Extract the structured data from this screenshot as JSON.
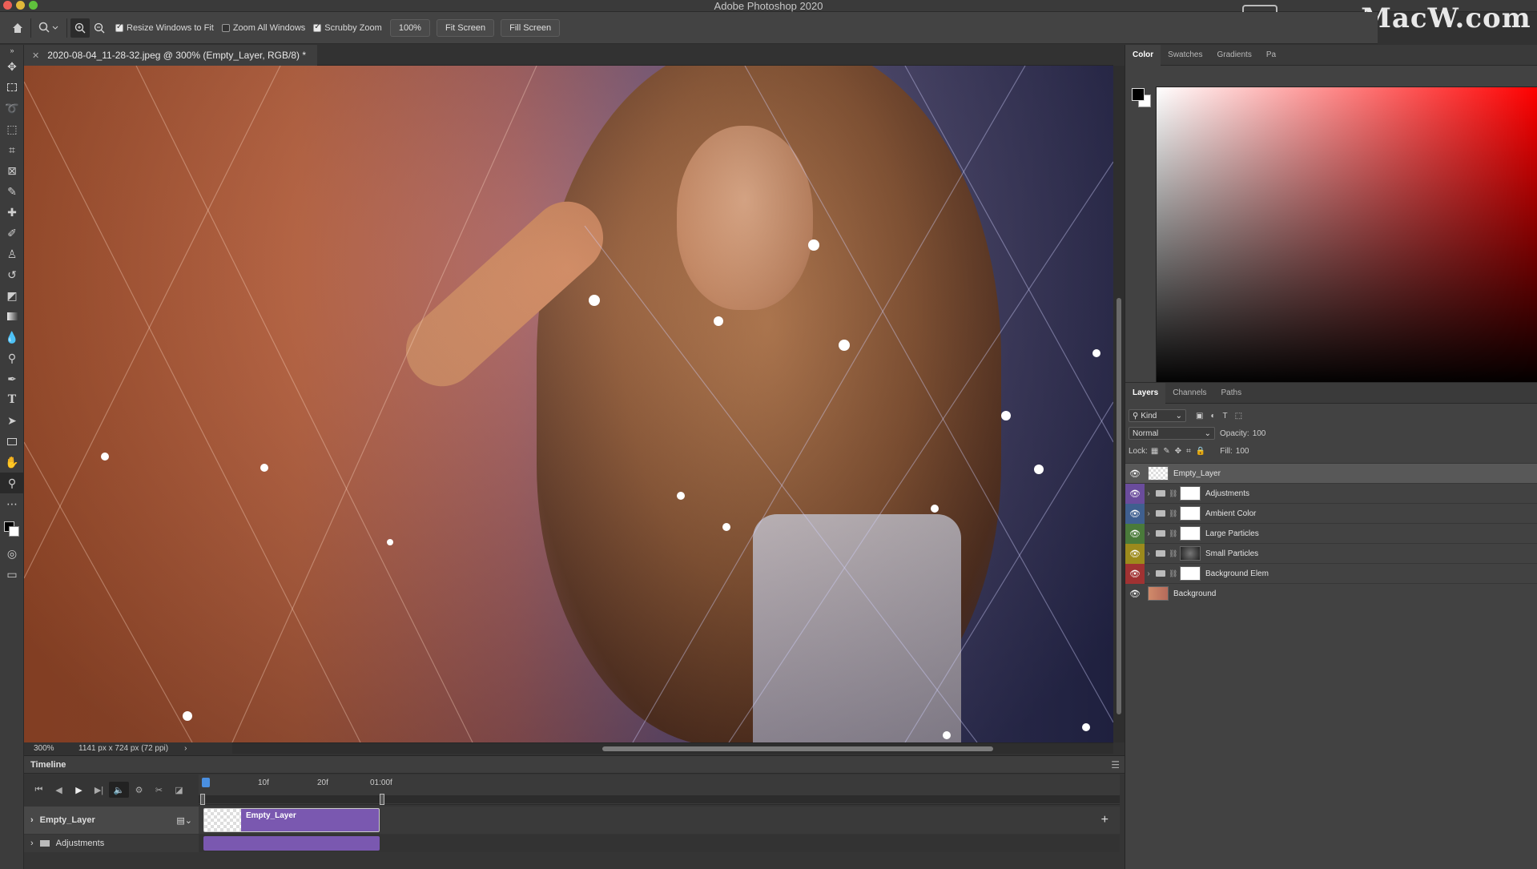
{
  "app": {
    "title": "Adobe Photoshop 2020",
    "watermark": "www.MacW.com"
  },
  "options_bar": {
    "resize_windows": "Resize Windows to Fit",
    "resize_windows_checked": true,
    "zoom_all_windows": "Zoom All Windows",
    "zoom_all_windows_checked": false,
    "scrubby_zoom": "Scrubby Zoom",
    "scrubby_zoom_checked": true,
    "zoom_value": "100%",
    "fit_screen": "Fit Screen",
    "fill_screen": "Fill Screen"
  },
  "document": {
    "tab_title": "2020-08-04_11-28-32.jpeg @ 300% (Empty_Layer, RGB/8) *",
    "zoom": "300%",
    "dimensions": "1141 px x 724 px (72 ppi)"
  },
  "timeline": {
    "title": "Timeline",
    "ticks": [
      "10f",
      "20f",
      "01:00f"
    ],
    "tracks": [
      {
        "name": "Empty_Layer",
        "clip_label": "Empty_Layer"
      },
      {
        "name": "Adjustments"
      }
    ]
  },
  "color_panel": {
    "tabs": [
      "Color",
      "Swatches",
      "Gradients",
      "Pa"
    ],
    "active_tab": "Color",
    "foreground": "#000000",
    "background": "#ffffff"
  },
  "layers_panel": {
    "tabs": [
      "Layers",
      "Channels",
      "Paths"
    ],
    "filter_kind": "Kind",
    "blend_mode": "Normal",
    "opacity_label": "Opacity:",
    "opacity_value": "100",
    "lock_label": "Lock:",
    "fill_label": "Fill:",
    "fill_value": "100",
    "layers": [
      {
        "name": "Empty_Layer",
        "color": "",
        "group": false
      },
      {
        "name": "Adjustments",
        "color": "#6a4c9c",
        "group": true
      },
      {
        "name": "Ambient Color",
        "color": "#3f5f8f",
        "group": true
      },
      {
        "name": "Large Particles",
        "color": "#4a7a3a",
        "group": true
      },
      {
        "name": "Small Particles",
        "color": "#9c8a1c",
        "group": true
      },
      {
        "name": "Background Elem",
        "color": "#a03232",
        "group": true
      },
      {
        "name": "Background",
        "color": "",
        "group": false
      }
    ]
  }
}
